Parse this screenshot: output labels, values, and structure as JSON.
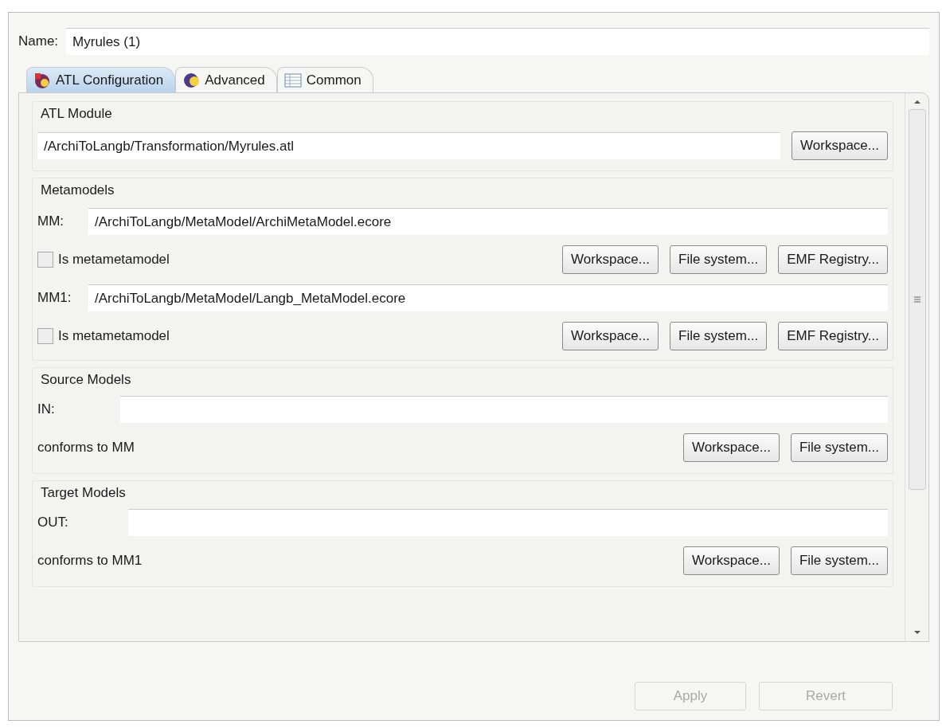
{
  "name_field": {
    "label": "Name:",
    "value": "Myrules (1)"
  },
  "tabs": [
    {
      "label": "ATL Configuration",
      "selected": true,
      "kind": "atl"
    },
    {
      "label": "Advanced",
      "selected": false,
      "kind": "advanced"
    },
    {
      "label": "Common",
      "selected": false,
      "kind": "common"
    }
  ],
  "atl_module": {
    "title": "ATL Module",
    "path": "/ArchiToLangb/Transformation/Myrules.atl",
    "button": "Workspace..."
  },
  "metamodels": {
    "title": "Metamodels",
    "items": [
      {
        "label": "MM:",
        "path": "/ArchiToLangb/MetaModel/ArchiMetaModel.ecore",
        "checkbox": {
          "label": "Is metametamodel",
          "checked": false
        },
        "buttons": [
          "Workspace...",
          "File system...",
          "EMF Registry..."
        ]
      },
      {
        "label": "MM1:",
        "path": "/ArchiToLangb/MetaModel/Langb_MetaModel.ecore",
        "checkbox": {
          "label": "Is metametamodel",
          "checked": false
        },
        "buttons": [
          "Workspace...",
          "File system...",
          "EMF Registry..."
        ]
      }
    ]
  },
  "source_models": {
    "title": "Source Models",
    "label": "IN:",
    "conforms": "conforms to MM",
    "buttons": [
      "Workspace...",
      "File system..."
    ]
  },
  "target_models": {
    "title": "Target Models",
    "label": "OUT:",
    "conforms": "conforms to MM1",
    "buttons": [
      "Workspace...",
      "File system..."
    ]
  },
  "buttons": [
    {
      "label": "Apply",
      "disabled": true
    },
    {
      "label": "Revert",
      "disabled": true
    }
  ]
}
